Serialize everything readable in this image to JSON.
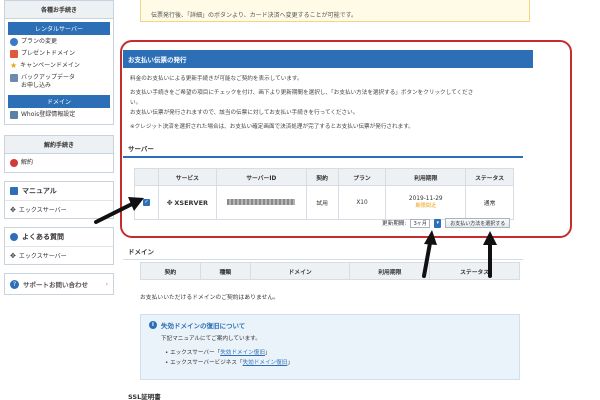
{
  "sidebar": {
    "procedures_title": "各種お手続き",
    "rental_server_label": "レンタルサーバー",
    "rental_items": [
      {
        "icon": "plan-change-icon",
        "label": "プランの変更",
        "color": "#3a78c9"
      },
      {
        "icon": "gift-icon",
        "label": "プレゼントドメイン",
        "color": "#e05a3a"
      },
      {
        "icon": "star-icon",
        "label": "キャンペーンドメイン",
        "color": "#e8a317"
      },
      {
        "icon": "backup-icon",
        "label": "バックアップデータ\nお申し込み",
        "color": "#6b8bb0"
      }
    ],
    "domain_label": "ドメイン",
    "domain_items": [
      {
        "icon": "document-icon",
        "label": "Whois登録情報設定",
        "color": "#5b7fa6"
      }
    ],
    "cancel_title": "解約手続き",
    "cancel_item": {
      "icon": "cancel-icon",
      "label": "解約",
      "color": "#d03a3a"
    },
    "manual_title": "マニュアル",
    "manual_item": "エックスサーバー",
    "faq_title": "よくある質問",
    "faq_item": "エックスサーバー",
    "contact_label": "サポートお問い合わせ"
  },
  "notice": {
    "line": "伝票発行後、「詳細」のボタンより、カード決済へ変更することが可能です。"
  },
  "invoice": {
    "title": "お支払い伝票の発行",
    "lines": [
      "料金のお支払いによる更新手続きが可能なご契約を表示しています。",
      "お支払い手続きをご希望の項目にチェックを付け、画下より更新期間を選択し、「お支払い方法を選択する」ボタンをクリックしてくださ",
      "い。",
      "お支払い伝票が発行されますので、該当の伝票に対してお支払い手続きを行ってください。",
      "※クレジット決済を選択された場合は、お支払い確定画面で決済処理が完了するとお支払い伝票が発行されます。"
    ],
    "server_section": "サーバー",
    "columns": [
      "サービス",
      "サーバーID",
      "契約",
      "プラン",
      "利用期限",
      "ステータス"
    ],
    "row": {
      "service": "XSERVER",
      "contract": "試用",
      "plan": "X10",
      "expiry": "2019-11-29",
      "expiry_note": "期限間近",
      "status": "通常"
    },
    "period_label": "更新期間:",
    "period_value": "3ヶ月",
    "select_button": "お支払い方法を選択する"
  },
  "domain_section": {
    "title": "ドメイン",
    "columns": [
      "契約",
      "種類",
      "ドメイン",
      "利用期限",
      "ステータス"
    ],
    "empty": "お支払いいただけるドメインのご契約はありません。"
  },
  "restore": {
    "title": "失効ドメインの復旧について",
    "sub": "下記マニュアルにてご案内しています。",
    "items": [
      {
        "prefix": "エックスサーバー「",
        "link": "失効ドメイン復旧",
        "suffix": "」"
      },
      {
        "prefix": "エックスサーバービジネス「",
        "link": "失効ドメイン復旧",
        "suffix": "」"
      }
    ]
  },
  "ssl_title": "SSL証明書",
  "colors": {
    "accent": "#2c6fb7",
    "highlight_frame": "#c42d2d",
    "expiry_warning": "#e8a317"
  }
}
